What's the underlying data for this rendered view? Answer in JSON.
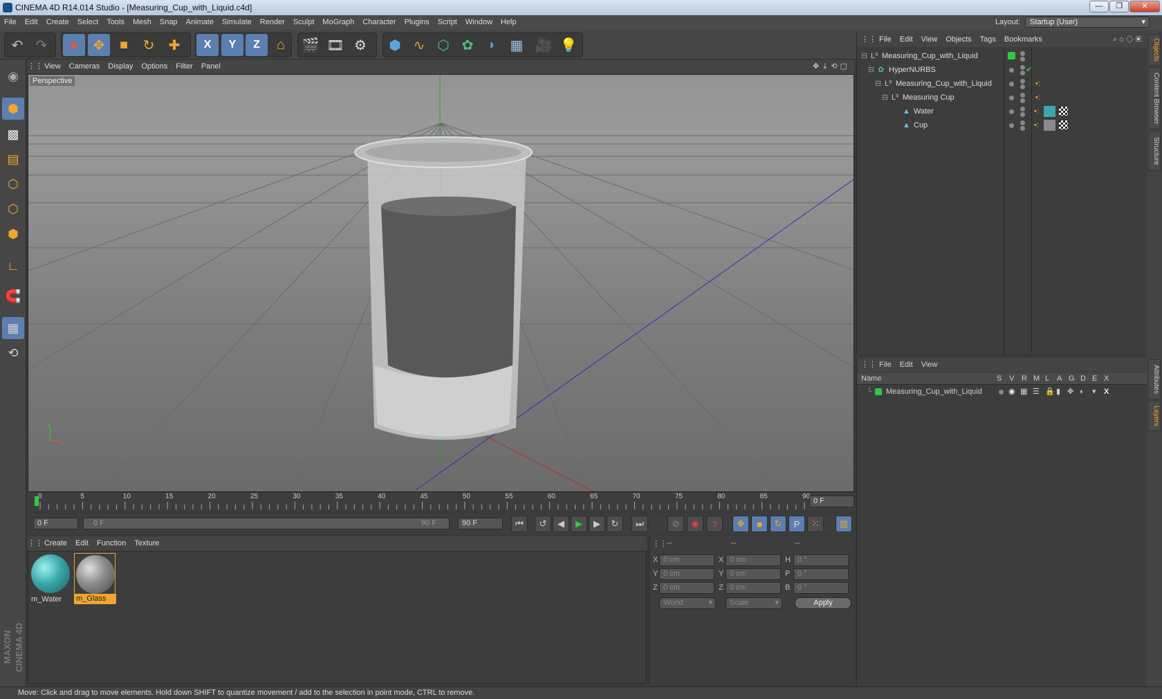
{
  "window": {
    "title": "CINEMA 4D R14.014 Studio - [Measuring_Cup_with_Liquid.c4d]",
    "min": "—",
    "max": "❐",
    "close": "✕"
  },
  "menubar": {
    "items": [
      "File",
      "Edit",
      "Create",
      "Select",
      "Tools",
      "Mesh",
      "Snap",
      "Animate",
      "Simulate",
      "Render",
      "Sculpt",
      "MoGraph",
      "Character",
      "Plugins",
      "Script",
      "Window",
      "Help"
    ],
    "layout_label": "Layout:",
    "layout_value": "Startup (User)"
  },
  "toolbar": {
    "axis_x": "X",
    "axis_y": "Y",
    "axis_z": "Z"
  },
  "viewport": {
    "menu": [
      "View",
      "Cameras",
      "Display",
      "Options",
      "Filter",
      "Panel"
    ],
    "camera_label": "Perspective",
    "axis_y": "y",
    "axis_z": "z",
    "axis_x": "x"
  },
  "timeline": {
    "ticks": [
      "0",
      "5",
      "10",
      "15",
      "20",
      "25",
      "30",
      "35",
      "40",
      "45",
      "50",
      "55",
      "60",
      "65",
      "70",
      "75",
      "80",
      "85",
      "90"
    ],
    "current_frame": "0 F"
  },
  "transport": {
    "start_field": "0 F",
    "range_start": "0 F",
    "range_end": "90 F",
    "end_field": "90 F"
  },
  "material_manager": {
    "menu": [
      "Create",
      "Edit",
      "Function",
      "Texture"
    ],
    "materials": [
      {
        "name": "m_Water",
        "color": "#3aa8a8"
      },
      {
        "name": "m_Glass",
        "color": "#8a8a8a"
      }
    ]
  },
  "coordinates": {
    "header": [
      "--",
      "--",
      "--"
    ],
    "rows": [
      {
        "l1": "X",
        "v1": "0 cm",
        "l2": "X",
        "v2": "0 cm",
        "l3": "H",
        "v3": "0 °"
      },
      {
        "l1": "Y",
        "v1": "0 cm",
        "l2": "Y",
        "v2": "0 cm",
        "l3": "P",
        "v3": "0 °"
      },
      {
        "l1": "Z",
        "v1": "0 cm",
        "l2": "Z",
        "v2": "0 cm",
        "l3": "B",
        "v3": "0 °"
      }
    ],
    "world": "World",
    "scale": "Scale",
    "apply": "Apply"
  },
  "object_manager": {
    "menu": [
      "File",
      "Edit",
      "View",
      "Objects",
      "Tags",
      "Bookmarks"
    ],
    "tree": [
      {
        "name": "Measuring_Cup_with_Liquid",
        "indent": 0,
        "icon": "null-icon"
      },
      {
        "name": "HyperNURBS",
        "indent": 1,
        "icon": "hypernurbs-icon"
      },
      {
        "name": "Measuring_Cup_with_Liquid",
        "indent": 2,
        "icon": "null-icon"
      },
      {
        "name": "Measuring Cup",
        "indent": 3,
        "icon": "null-icon"
      },
      {
        "name": "Water",
        "indent": 4,
        "icon": "polygon-icon"
      },
      {
        "name": "Cup",
        "indent": 4,
        "icon": "polygon-icon"
      }
    ]
  },
  "layer_manager": {
    "menu": [
      "File",
      "Edit",
      "View"
    ],
    "columns": [
      "Name",
      "S",
      "V",
      "R",
      "M",
      "L",
      "A",
      "G",
      "D",
      "E",
      "X"
    ],
    "layers": [
      {
        "name": "Measuring_Cup_with_Liquid",
        "color": "#2ecc40"
      }
    ]
  },
  "side_tabs": [
    "Objects",
    "Content Browser",
    "Structure",
    "Attributes",
    "Layers"
  ],
  "status": "Move: Click and drag to move elements. Hold down SHIFT to quantize movement / add to the selection in point mode, CTRL to remove."
}
